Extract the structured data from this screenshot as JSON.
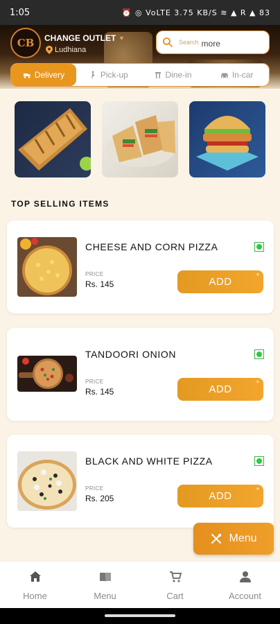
{
  "status_bar": {
    "time": "1:05",
    "indicators": "⏰ ◎ VoLTE 3.75 KB/S ≋ ▲ R ▲ 83"
  },
  "header": {
    "logo_text": "CB",
    "outlet_name": "CHANGE OUTLET",
    "outlet_caret": "▼",
    "city": "Ludhiana",
    "search_placeholder": "Search",
    "search_value": "more"
  },
  "order_modes": [
    {
      "label": "Delivery",
      "icon": "delivery-icon",
      "active": true
    },
    {
      "label": "Pick-up",
      "icon": "pickup-icon",
      "active": false
    },
    {
      "label": "Dine-in",
      "icon": "dine-in-icon",
      "active": false
    },
    {
      "label": "In-car",
      "icon": "car-icon",
      "active": false
    }
  ],
  "categories": [
    {
      "image": "garlic-bread-image"
    },
    {
      "image": "wraps-image"
    },
    {
      "image": "burger-image"
    }
  ],
  "section_title": "TOP SELLING ITEMS",
  "items": [
    {
      "name": "CHEESE AND CORN PIZZA",
      "price_label": "PRICE",
      "price": "Rs. 145",
      "add_label": "ADD",
      "plus": "+"
    },
    {
      "name": "TANDOORI ONION",
      "price_label": "PRICE",
      "price": "Rs. 145",
      "add_label": "ADD",
      "plus": "+"
    },
    {
      "name": "BLACK AND WHITE PIZZA",
      "price_label": "PRICE",
      "price": "Rs. 205",
      "add_label": "ADD",
      "plus": "+"
    }
  ],
  "fab": {
    "label": "Menu"
  },
  "bottom_nav": [
    {
      "label": "Home",
      "icon": "home-icon"
    },
    {
      "label": "Menu",
      "icon": "menu-book-icon"
    },
    {
      "label": "Cart",
      "icon": "cart-icon"
    },
    {
      "label": "Account",
      "icon": "account-icon"
    }
  ],
  "colors": {
    "accent": "#e9961f",
    "veg": "#2ec93e",
    "background": "#fbf4e6"
  }
}
